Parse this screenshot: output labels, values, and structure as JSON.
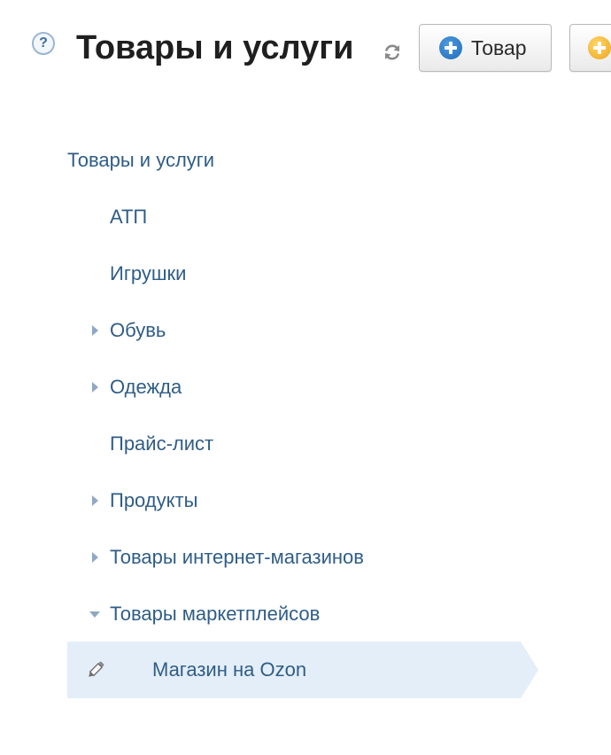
{
  "header": {
    "help_glyph": "?",
    "title": "Товары и услуги",
    "refresh_icon": "refresh-icon",
    "buttons": [
      {
        "label": "Товар",
        "icon": "plus-circle-icon",
        "color": "#1f6bb9"
      },
      {
        "label": "",
        "icon": "plus-circle-icon",
        "color": "#efa41a"
      }
    ]
  },
  "tree": {
    "root_label": "Товары и услуги",
    "items": [
      {
        "label": "АТП",
        "expander": "none"
      },
      {
        "label": "Игрушки",
        "expander": "none"
      },
      {
        "label": "Обувь",
        "expander": "collapsed"
      },
      {
        "label": "Одежда",
        "expander": "collapsed"
      },
      {
        "label": "Прайс-лист",
        "expander": "none"
      },
      {
        "label": "Продукты",
        "expander": "collapsed"
      },
      {
        "label": "Товары интернет-магазинов",
        "expander": "collapsed"
      },
      {
        "label": "Товары маркетплейсов",
        "expander": "expanded"
      }
    ],
    "selected": {
      "label": "Магазин на Ozon",
      "icon": "pencil-icon"
    }
  },
  "colors": {
    "link": "#2f5d87",
    "title": "#1f1f1f",
    "selection_bg": "#e4eef8",
    "expander": "#8fa8c4"
  }
}
